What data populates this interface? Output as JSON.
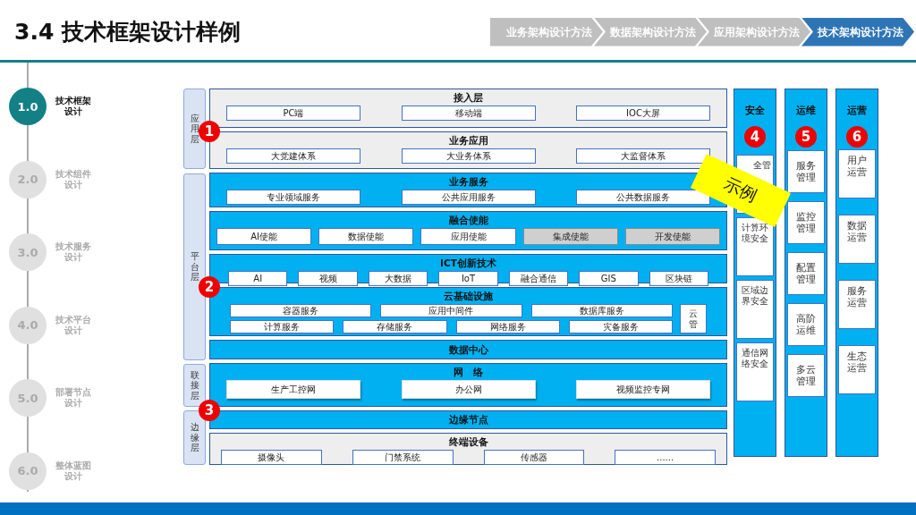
{
  "header": {
    "title": "3.4 技术框架设计样例",
    "steps": [
      {
        "label": "业务架构设计方法",
        "selected": false
      },
      {
        "label": "数据架构设计方法",
        "selected": false
      },
      {
        "label": "应用架构设计方法",
        "selected": false
      },
      {
        "label": "技术架构设计方法",
        "selected": true
      }
    ]
  },
  "sidebar": {
    "items": [
      {
        "number": "1.0",
        "label": "技术框架设计",
        "selected": true
      },
      {
        "number": "2.0",
        "label": "技术组件设计",
        "selected": false
      },
      {
        "number": "3.0",
        "label": "技术服务设计",
        "selected": false
      },
      {
        "number": "4.0",
        "label": "技术平台设计",
        "selected": false
      },
      {
        "number": "5.0",
        "label": "部署节点设计",
        "selected": false
      },
      {
        "number": "6.0",
        "label": "整体蓝图设计",
        "selected": false
      }
    ]
  },
  "layer_labels": [
    {
      "label": "应用层"
    },
    {
      "label": "平台层"
    },
    {
      "label": "联接层"
    },
    {
      "label": "边缘层"
    }
  ],
  "layers": [
    {
      "title": "接入层",
      "kind": "grey",
      "items": [
        {
          "label": "PC端",
          "disabled": false
        },
        {
          "label": "移动端",
          "disabled": false
        },
        {
          "label": "IOC大屏",
          "disabled": false
        }
      ]
    },
    {
      "title": "业务应用",
      "kind": "grey",
      "badge": "1",
      "items": [
        {
          "label": "大党建体系",
          "disabled": false
        },
        {
          "label": "大业务体系",
          "disabled": false
        },
        {
          "label": "大监督体系",
          "disabled": false
        }
      ]
    },
    {
      "title": "业务服务",
      "kind": "blue",
      "items": [
        {
          "label": "专业领域服务",
          "disabled": false
        },
        {
          "label": "公共应用服务",
          "disabled": false
        },
        {
          "label": "公共数据服务",
          "disabled": false
        }
      ]
    },
    {
      "title": "融合使能",
      "kind": "blue",
      "items": [
        {
          "label": "AI使能",
          "disabled": false
        },
        {
          "label": "数据使能",
          "disabled": false
        },
        {
          "label": "应用使能",
          "disabled": false
        },
        {
          "label": "集成使能",
          "disabled": true
        },
        {
          "label": "开发使能",
          "disabled": true
        }
      ]
    },
    {
      "title": "ICT创新技术",
      "kind": "blue",
      "items": [
        {
          "label": "AI",
          "disabled": false
        },
        {
          "label": "视频",
          "disabled": false
        },
        {
          "label": "大数据",
          "disabled": false
        },
        {
          "label": "IoT",
          "disabled": false
        },
        {
          "label": "融合通信",
          "disabled": false
        },
        {
          "label": "GIS",
          "disabled": false
        },
        {
          "label": "区块链",
          "disabled": false
        }
      ]
    },
    {
      "title": "云基础设施",
      "kind": "blue",
      "badge": "2",
      "rows": [
        [
          "容器服务",
          "应用中间件",
          "数据库服务"
        ],
        [
          "计算服务",
          "存储服务",
          "网络服务",
          "灾备服务"
        ]
      ],
      "side_item": "云管"
    },
    {
      "title": "数据中心",
      "kind": "blue"
    },
    {
      "title": "网　络",
      "kind": "blue",
      "items": [
        {
          "label": "生产工控网",
          "disabled": false
        },
        {
          "label": "办公网",
          "disabled": false
        },
        {
          "label": "视频监控专网",
          "disabled": false
        }
      ]
    },
    {
      "title": "边缘节点",
      "kind": "blue",
      "badge": "3"
    },
    {
      "title": "终端设备",
      "kind": "grey",
      "items": [
        {
          "label": "摄像头",
          "disabled": false
        },
        {
          "label": "门禁系统",
          "disabled": false
        },
        {
          "label": "传感器",
          "disabled": false
        },
        {
          "label": "......",
          "disabled": false
        }
      ]
    }
  ],
  "side_columns": [
    {
      "title": "安全",
      "badge": "4",
      "items": [
        "全管",
        "计算环境安全",
        "区域边界安全",
        "通信网络安全"
      ]
    },
    {
      "title": "运维",
      "badge": "5",
      "items": [
        "服务管理",
        "监控管理",
        "配置管理",
        "高阶运维",
        "多云管理"
      ]
    },
    {
      "title": "运营",
      "badge": "6",
      "items": [
        "用户运营",
        "数据运营",
        "服务运营",
        "生态运营"
      ]
    }
  ],
  "stamp": {
    "text": "示例"
  }
}
